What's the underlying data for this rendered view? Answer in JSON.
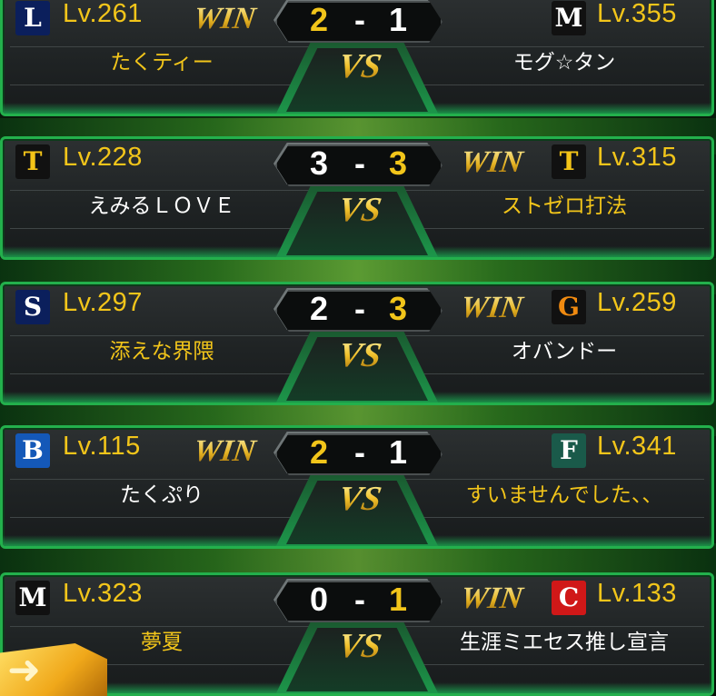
{
  "matches": [
    {
      "left": {
        "team_icon": "seibu-lions-logo",
        "logo_text": "L",
        "logo_bg": "#0b1f5c",
        "logo_fg": "#ffffff",
        "level": "Lv.261",
        "name": "たくティー",
        "name_color": "gold",
        "score": "2",
        "win": true,
        "win_label": "WIN"
      },
      "right": {
        "team_icon": "lotte-marines-logo",
        "logo_text": "M",
        "logo_bg": "#111111",
        "logo_fg": "#ffffff",
        "level": "Lv.355",
        "name": "モグ☆タン",
        "name_color": "white",
        "score": "1",
        "win": false,
        "win_label": ""
      },
      "separator": "-",
      "vs": "VS"
    },
    {
      "left": {
        "team_icon": "hanshin-tigers-logo",
        "logo_text": "T",
        "logo_bg": "#111111",
        "logo_fg": "#f5c518",
        "level": "Lv.228",
        "name": "えみるＬＯＶＥ",
        "name_color": "white",
        "score": "3",
        "win": false,
        "win_label": ""
      },
      "right": {
        "team_icon": "hanshin-tigers-logo",
        "logo_text": "T",
        "logo_bg": "#111111",
        "logo_fg": "#f5c518",
        "level": "Lv.315",
        "name": "ストゼロ打法",
        "name_color": "gold",
        "score": "3",
        "win": true,
        "win_label": "WIN"
      },
      "separator": "-",
      "vs": "VS"
    },
    {
      "left": {
        "team_icon": "yakult-swallows-logo",
        "logo_text": "S",
        "logo_bg": "#0b1f5c",
        "logo_fg": "#ffffff",
        "level": "Lv.297",
        "name": "添えな界隈",
        "name_color": "gold",
        "score": "2",
        "win": false,
        "win_label": ""
      },
      "right": {
        "team_icon": "giants-logo",
        "logo_text": "G",
        "logo_bg": "#111111",
        "logo_fg": "#f08a10",
        "level": "Lv.259",
        "name": "オバンドー",
        "name_color": "white",
        "score": "3",
        "win": true,
        "win_label": "WIN"
      },
      "separator": "-",
      "vs": "VS"
    },
    {
      "left": {
        "team_icon": "baystars-logo",
        "logo_text": "B",
        "logo_bg": "#1458b8",
        "logo_fg": "#ffffff",
        "level": "Lv.115",
        "name": "たくぷり",
        "name_color": "white",
        "score": "2",
        "win": true,
        "win_label": "WIN"
      },
      "right": {
        "team_icon": "fighters-logo",
        "logo_text": "F",
        "logo_bg": "#1a5a4a",
        "logo_fg": "#ffffff",
        "level": "Lv.341",
        "name": "すいませんでした、、",
        "name_color": "gold",
        "score": "1",
        "win": false,
        "win_label": ""
      },
      "separator": "-",
      "vs": "VS"
    },
    {
      "left": {
        "team_icon": "lotte-marines-logo",
        "logo_text": "M",
        "logo_bg": "#111111",
        "logo_fg": "#ffffff",
        "level": "Lv.323",
        "name": "夢夏",
        "name_color": "gold",
        "score": "0",
        "win": false,
        "win_label": ""
      },
      "right": {
        "team_icon": "carp-logo",
        "logo_text": "C",
        "logo_bg": "#d01818",
        "logo_fg": "#ffffff",
        "level": "Lv.133",
        "name": "生涯ミエセス推し宣言",
        "name_color": "white",
        "score": "1",
        "win": true,
        "win_label": "WIN"
      },
      "separator": "-",
      "vs": "VS"
    }
  ],
  "colors": {
    "accent_green": "#23b04c",
    "gold": "#f2c51a",
    "panel": "#24282a"
  },
  "corner_icon": "back-arrow-icon"
}
